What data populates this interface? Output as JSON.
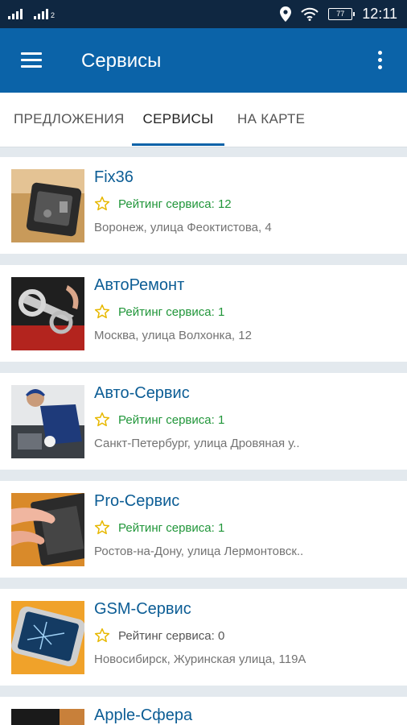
{
  "status_bar": {
    "sim1_label": "",
    "sim2_label": "2",
    "battery": "77",
    "time": "12:11"
  },
  "app_bar": {
    "title": "Сервисы"
  },
  "tabs": [
    {
      "label": "ПРЕДЛОЖЕНИЯ"
    },
    {
      "label": "СЕРВИСЫ"
    },
    {
      "label": "НА КАРТЕ"
    }
  ],
  "colors": {
    "status_bar": "#0f2741",
    "app_bar": "#0b63a8",
    "title_link": "#0c5d95",
    "rating_green": "#21963a",
    "star": "#e7b800"
  },
  "services": [
    {
      "name": "Fix36",
      "rating": "Рейтинг сервиса: 12",
      "address": "Воронеж, улица Феоктистова, 4",
      "thumb": "phone-repair-photo"
    },
    {
      "name": "АвтоРемонт",
      "rating": "Рейтинг сервиса: 1",
      "address": "Москва, улица Волхонка, 12",
      "thumb": "wrench-photo"
    },
    {
      "name": "Авто-Сервис",
      "rating": "Рейтинг сервиса: 1",
      "address": "Санкт-Петербург, улица Дровяная у..",
      "thumb": "mechanic-photo"
    },
    {
      "name": "Pro-Сервис",
      "rating": "Рейтинг сервиса: 1",
      "address": "Ростов-на-Дону, улица Лермонтовск..",
      "thumb": "laptop-repair-photo"
    },
    {
      "name": "GSM-Сервис",
      "rating": "Рейтинг сервиса: 0",
      "address": "Новосибирск, Журинская улица, 119А",
      "thumb": "broken-phone-photo"
    },
    {
      "name": "Apple-Сфера",
      "rating": "",
      "address": "",
      "thumb": "device-photo"
    }
  ]
}
